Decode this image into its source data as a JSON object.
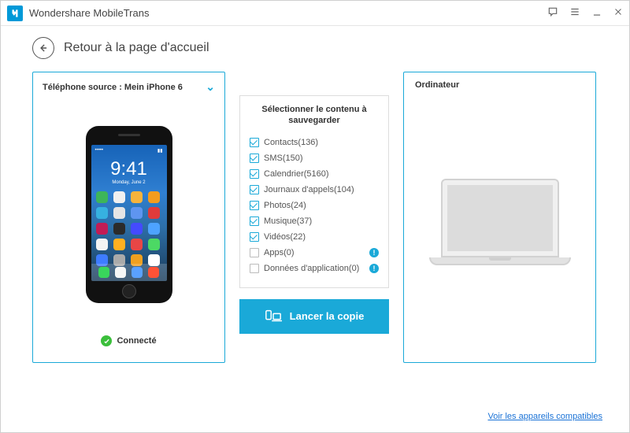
{
  "app_title": "Wondershare MobileTrans",
  "back_label": "Retour à la page d'accueil",
  "source": {
    "header_prefix": "Téléphone source : ",
    "device_name": "Mein iPhone 6",
    "status": "Connecté",
    "phone": {
      "time": "9:41",
      "date": "Monday, June 2"
    }
  },
  "select": {
    "title": "Sélectionner le contenu à sauvegarder",
    "items": [
      {
        "label": "Contacts(136)",
        "checked": true,
        "info": false
      },
      {
        "label": "SMS(150)",
        "checked": true,
        "info": false
      },
      {
        "label": "Calendrier(5160)",
        "checked": true,
        "info": false
      },
      {
        "label": "Journaux d'appels(104)",
        "checked": true,
        "info": false
      },
      {
        "label": "Photos(24)",
        "checked": true,
        "info": false
      },
      {
        "label": "Musique(37)",
        "checked": true,
        "info": false
      },
      {
        "label": "Vidéos(22)",
        "checked": true,
        "info": false
      },
      {
        "label": "Apps(0)",
        "checked": false,
        "info": true
      },
      {
        "label": "Données d'application(0)",
        "checked": false,
        "info": true
      }
    ],
    "launch_label": "Lancer la copie"
  },
  "dest": {
    "title": "Ordinateur"
  },
  "footer_link": "Voir les appareils compatibles",
  "app_tiles": [
    "#3db55a",
    "#f0f0f0",
    "#f6b33c",
    "#f39c1e",
    "#36b1e0",
    "#e5e5e5",
    "#5e95f0",
    "#e03b3b",
    "#c21c55",
    "#2b2b2b",
    "#444aff",
    "#4da3ff",
    "#f3f3f3",
    "#ffb020",
    "#e84646",
    "#4cd964",
    "#3e7cff",
    "#aaaaaa",
    "#f0a020",
    "#ffffff"
  ],
  "dock_tiles": [
    "#39d65c",
    "#f6f6f6",
    "#5aa1ff",
    "#ff5236"
  ]
}
